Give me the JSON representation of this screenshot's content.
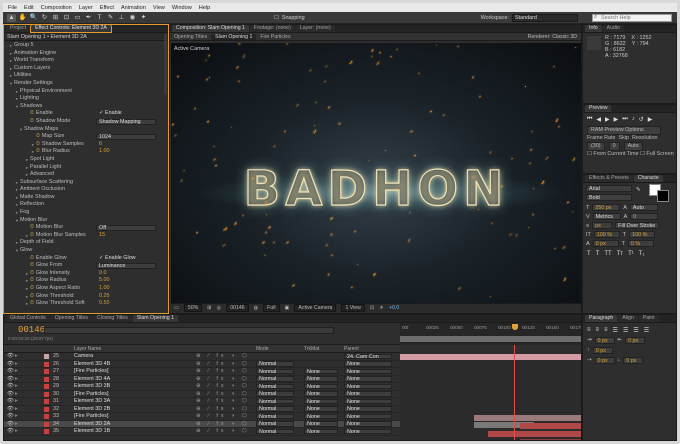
{
  "menu": [
    "File",
    "Edit",
    "Composition",
    "Layer",
    "Effect",
    "Animation",
    "View",
    "Window",
    "Help"
  ],
  "toolbar": {
    "tools": [
      "▲",
      "✋",
      "🔍",
      "↻",
      "⊞",
      "⊡",
      "▭",
      "✒",
      "T",
      "✎",
      "⊥",
      "◉",
      "✦"
    ],
    "snapping": "Snapping",
    "workspace_label": "Workspace:",
    "workspace_value": "Standard",
    "search_placeholder": "Search Help"
  },
  "project": {
    "tabs": [
      "Project",
      "Effect Controls: Element 3D 2A"
    ],
    "header": "Slam Opening 1 • Element 3D 2A",
    "rows": [
      {
        "t": "▸",
        "label": "Group 5",
        "ind": 4
      },
      {
        "t": "▸",
        "label": "Animation Engine",
        "ind": 4
      },
      {
        "t": "▸",
        "label": "World Transform",
        "ind": 4
      },
      {
        "t": "▸",
        "label": "Custom Layers",
        "ind": 4
      },
      {
        "t": "▸",
        "label": "Utilities",
        "ind": 4
      },
      {
        "t": "▾",
        "label": "Render Settings",
        "ind": 4
      },
      {
        "t": "▸",
        "label": "Physical Environment",
        "ind": 10
      },
      {
        "t": "▸",
        "label": "Lighting",
        "ind": 10
      },
      {
        "t": "▾",
        "label": "Shadows",
        "ind": 10
      },
      {
        "t": "",
        "label": "Enable",
        "ind": 20,
        "sw": true,
        "val": "✓ Enable",
        "vw": true
      },
      {
        "t": "",
        "label": "Shadow Mode",
        "ind": 20,
        "sw": true,
        "drop": "Shadow Mapping"
      },
      {
        "t": "▾",
        "label": "Shadow Maps",
        "ind": 14
      },
      {
        "t": "",
        "label": "Map Size",
        "ind": 26,
        "sw": true,
        "drop": "1024"
      },
      {
        "t": "▸",
        "label": "Shadow Samples",
        "ind": 26,
        "sw": true,
        "val": "6"
      },
      {
        "t": "▸",
        "label": "Blur Radius",
        "ind": 26,
        "sw": true,
        "val": "1.00"
      },
      {
        "t": "▸",
        "label": "Spot Light",
        "ind": 20
      },
      {
        "t": "▸",
        "label": "Parallel Light",
        "ind": 20
      },
      {
        "t": "▸",
        "label": "Advanced",
        "ind": 20
      },
      {
        "t": "▸",
        "label": "Subsurface Scattering",
        "ind": 10
      },
      {
        "t": "▸",
        "label": "Ambient Occlusion",
        "ind": 10
      },
      {
        "t": "▸",
        "label": "Matte Shadow",
        "ind": 10
      },
      {
        "t": "▸",
        "label": "Reflection",
        "ind": 10
      },
      {
        "t": "▸",
        "label": "Fog",
        "ind": 10
      },
      {
        "t": "▾",
        "label": "Motion Blur",
        "ind": 10
      },
      {
        "t": "",
        "label": "Motion Blur",
        "ind": 20,
        "sw": true,
        "drop": "Off"
      },
      {
        "t": "▸",
        "label": "Motion Blur Samples",
        "ind": 20,
        "sw": true,
        "val": "15"
      },
      {
        "t": "▸",
        "label": "Depth of Field",
        "ind": 10
      },
      {
        "t": "▾",
        "label": "Glow",
        "ind": 10
      },
      {
        "t": "",
        "label": "Enable Glow",
        "ind": 20,
        "sw": true,
        "val": "✓ Enable Glow",
        "vw": true
      },
      {
        "t": "",
        "label": "Glow From",
        "ind": 20,
        "sw": true,
        "drop": "Luminance"
      },
      {
        "t": "▸",
        "label": "Glow Intensity",
        "ind": 20,
        "sw": true,
        "val": "0.0"
      },
      {
        "t": "▸",
        "label": "Glow Radius",
        "ind": 20,
        "sw": true,
        "val": "5.00"
      },
      {
        "t": "▸",
        "label": "Glow Aspect Ratio",
        "ind": 20,
        "sw": true,
        "val": "1.00"
      },
      {
        "t": "▸",
        "label": "Glow Threshold",
        "ind": 20,
        "sw": true,
        "val": "0.25"
      },
      {
        "t": "▸",
        "label": "Glow Threshold Soft",
        "ind": 20,
        "sw": true,
        "val": "0.50"
      }
    ]
  },
  "composition": {
    "tabs": [
      "Composition: Slam Opening 1",
      "Footage: (none)",
      "Layer: (none)"
    ],
    "sub": {
      "crumb1": "Opening Titles",
      "crumb2": "Slam Opening 1",
      "crumb3": "Fire Particles",
      "renderer_label": "Renderer:",
      "renderer_value": "Classic 3D"
    },
    "camera_label": "Active Camera",
    "title_text": "BADHON",
    "viewer_bar": {
      "zoom": "50%",
      "timecode": "00146",
      "res": "Full",
      "cam": "Active Camera",
      "views": "1 View",
      "exposure": "+0.0"
    }
  },
  "info": {
    "tabs": [
      "Info",
      "Audio"
    ],
    "r": "R : 7179",
    "g": "G : 8632",
    "b": "B : 6182",
    "a": "A : 32768",
    "x": "X : 1252",
    "y": "Y : 794"
  },
  "preview": {
    "tabs": [
      "Preview"
    ],
    "ram": "RAM Preview Options",
    "fr_label": "Frame Rate",
    "skip_label": "Skip",
    "res_label": "Resolution",
    "fr": "(30)",
    "skip": "0",
    "res": "Auto",
    "from_current": "From Current Time",
    "full_screen": "Full Screen"
  },
  "effects_char": {
    "tabs": [
      "Effects & Presets",
      "Characte"
    ],
    "font": "Arial",
    "style": "Bold",
    "size": "250 px",
    "leading": "Auto",
    "kerning": "Metrics",
    "tracking": "0",
    "stroke_px": "px",
    "fill_over": "Fill Over Stroke",
    "vscale": "100 %",
    "hscale": "100 %",
    "baseline": "0 px",
    "tsume": "0 %",
    "styles": [
      "T",
      "T",
      "TT",
      "Tт",
      "T¹",
      "T₁"
    ]
  },
  "timeline": {
    "tabs": [
      "Global Controls",
      "Opening Titles",
      "Closing Titles",
      "Slam Opening 1"
    ],
    "timecode": "00146",
    "fps": "0:00:04:26 (29.97 fps)",
    "ruler_ticks": [
      "00f",
      "00025",
      "00050",
      "00075",
      "00100",
      "00125",
      "00150",
      "00175"
    ],
    "columns": {
      "name": "Layer Name",
      "mode": "Mode",
      "trkmat": "TrkMat",
      "parent": "Parent"
    },
    "layers": [
      {
        "n": "25",
        "name": "Camera",
        "color": "#c7a6a6",
        "mode": "",
        "trk": "",
        "parent": "24. Cam Con"
      },
      {
        "n": "26",
        "name": "Element 3D 4B",
        "color": "#c94040",
        "mode": "Normal",
        "trk": "",
        "parent": "None"
      },
      {
        "n": "27",
        "name": "[Fire Particles]",
        "color": "#c94040",
        "mode": "Normal",
        "trk": "None",
        "parent": "None"
      },
      {
        "n": "28",
        "name": "Element 3D 4A",
        "color": "#c94040",
        "mode": "Normal",
        "trk": "None",
        "parent": "None"
      },
      {
        "n": "29",
        "name": "Element 3D 3B",
        "color": "#c94040",
        "mode": "Normal",
        "trk": "None",
        "parent": "None"
      },
      {
        "n": "30",
        "name": "[Fire Particles]",
        "color": "#c94040",
        "mode": "Normal",
        "trk": "None",
        "parent": "None"
      },
      {
        "n": "31",
        "name": "Element 3D 3A",
        "color": "#c94040",
        "mode": "Normal",
        "trk": "None",
        "parent": "None"
      },
      {
        "n": "32",
        "name": "Element 3D 2B",
        "color": "#c94040",
        "mode": "Normal",
        "trk": "None",
        "parent": "None"
      },
      {
        "n": "33",
        "name": "[Fire Particles]",
        "color": "#c94040",
        "mode": "Normal",
        "trk": "None",
        "parent": "None"
      },
      {
        "n": "34",
        "name": "Element 3D 2A",
        "color": "#c94040",
        "mode": "Normal",
        "trk": "None",
        "parent": "None",
        "sel": true
      },
      {
        "n": "35",
        "name": "Element 3D 1B",
        "color": "#c94040",
        "mode": "Normal",
        "trk": "None",
        "parent": "None"
      }
    ]
  },
  "paragraph": {
    "tabs": [
      "Paragraph",
      "Align",
      "Paint"
    ],
    "f1": "0 px",
    "f2": "0 px",
    "f3": "0 px",
    "f4": "0 px",
    "f5": "0 px"
  },
  "colors": {
    "accent": "#e39b2d",
    "cti": "#e0504a",
    "layer_red": "#c94040",
    "bar_pink": "#d39aa2"
  }
}
